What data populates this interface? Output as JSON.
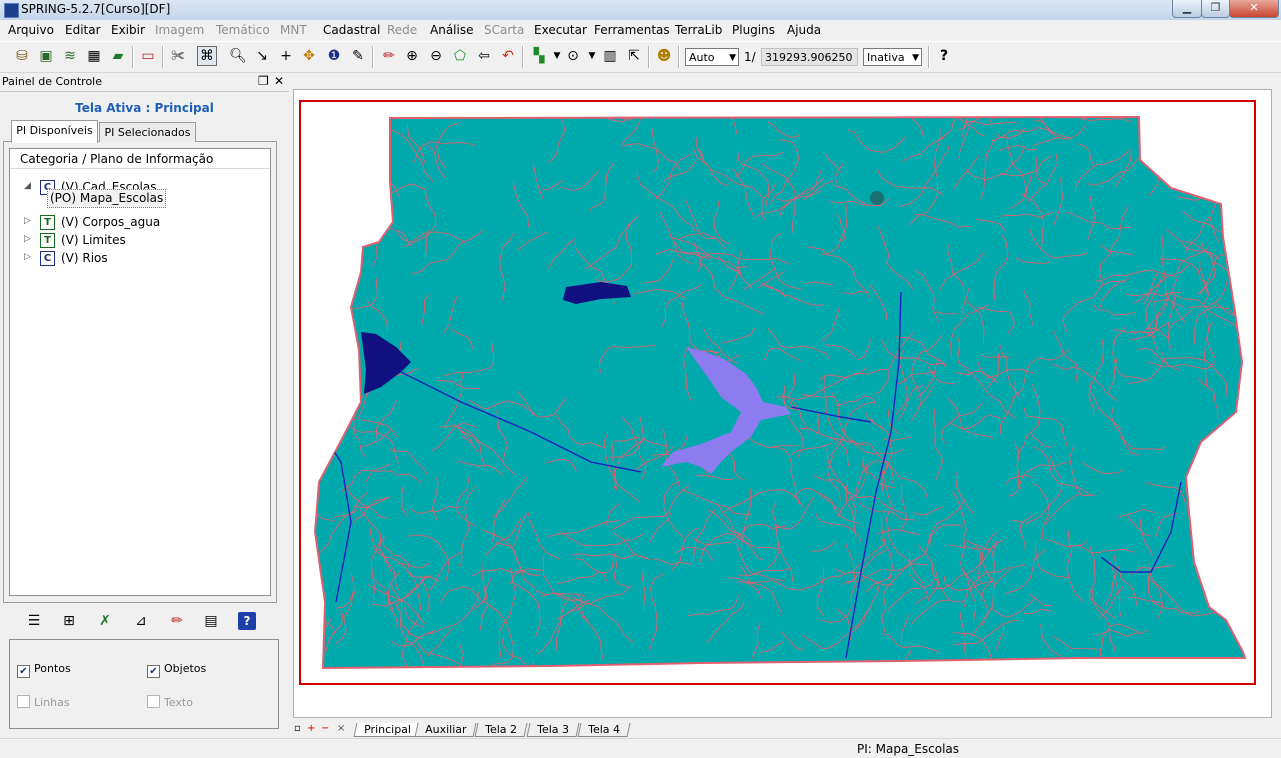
{
  "window": {
    "title": "SPRING-5.2.7[Curso][DF]"
  },
  "menu": [
    {
      "label": "Arquivo",
      "enabled": true
    },
    {
      "label": "Editar",
      "enabled": true
    },
    {
      "label": "Exibir",
      "enabled": true
    },
    {
      "label": "Imagem",
      "enabled": false
    },
    {
      "label": "Temático",
      "enabled": false
    },
    {
      "label": "MNT",
      "enabled": false
    },
    {
      "label": "Cadastral",
      "enabled": true
    },
    {
      "label": "Rede",
      "enabled": false
    },
    {
      "label": "Análise",
      "enabled": true
    },
    {
      "label": "SCarta",
      "enabled": false
    },
    {
      "label": "Executar",
      "enabled": true
    },
    {
      "label": "Ferramentas",
      "enabled": true
    },
    {
      "label": "TerraLib",
      "enabled": true
    },
    {
      "label": "Plugins",
      "enabled": true
    },
    {
      "label": "Ajuda",
      "enabled": true
    }
  ],
  "toolbar": {
    "zoom_mode": "Auto",
    "scale_prefix": "1/",
    "scale_value": "319293.906250",
    "state": "Inativa",
    "help_glyph": "?"
  },
  "panel": {
    "title": "Painel de Controle",
    "active_screen": "Tela Ativa : Principal",
    "tabs": [
      "PI Disponíveis",
      "PI Selecionados"
    ],
    "tree_header": "Categoria / Plano de Informação",
    "tree": [
      {
        "badge": "C",
        "label": "(V) Cad_Escolas",
        "expanded": true
      },
      {
        "badge": "T",
        "label": "(V) Corpos_agua",
        "expanded": false
      },
      {
        "badge": "T",
        "label": "(V) Limites",
        "expanded": false
      },
      {
        "badge": "C",
        "label": "(V) Rios",
        "expanded": false
      }
    ],
    "selected_child": "(PO) Mapa_Escolas",
    "visibility": {
      "pontos": {
        "label": "Pontos",
        "checked": true,
        "enabled": true
      },
      "objetos": {
        "label": "Objetos",
        "checked": true,
        "enabled": true
      },
      "linhas": {
        "label": "Linhas",
        "checked": false,
        "enabled": false
      },
      "texto": {
        "label": "Texto",
        "checked": false,
        "enabled": false
      }
    }
  },
  "screens": [
    "Principal",
    "Auxiliar",
    "Tela 2",
    "Tela 3",
    "Tela 4"
  ],
  "status": {
    "text": "PI: Mapa_Escolas"
  },
  "colors": {
    "map_fill": "#00a9ab",
    "drainage": "#e06070",
    "water_dark": "#101080",
    "water_light": "#8c7cf0",
    "frame": "#d10000"
  }
}
